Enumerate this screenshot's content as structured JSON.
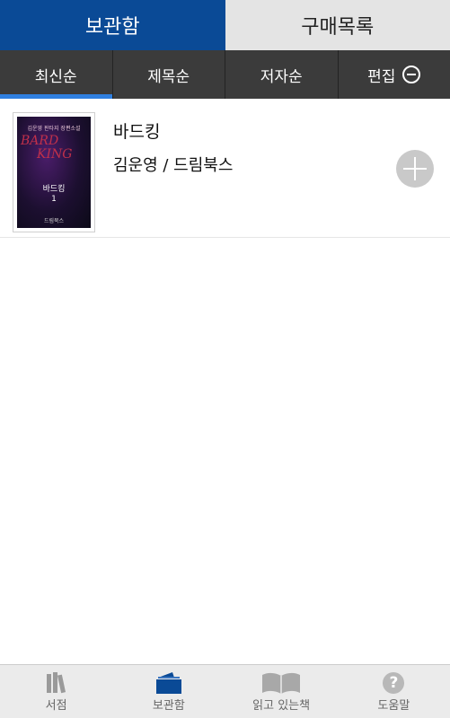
{
  "top_tabs": [
    {
      "label": "보관함",
      "active": true
    },
    {
      "label": "구매목록",
      "active": false
    }
  ],
  "sort_bar": {
    "items": [
      "최신순",
      "제목순",
      "저자순"
    ],
    "active_index": 0,
    "edit_label": "편집",
    "edit_icon": "minus-circle-icon"
  },
  "books": [
    {
      "title": "바드킹",
      "meta": "김운영 / 드림북스",
      "cover": {
        "subtitle": "김운영 판타지 장편소설",
        "logo_line1": "BARD",
        "logo_line2": "KING",
        "title": "바드킹",
        "volume": "1",
        "publisher": "드림북스"
      },
      "action_icon": "plus-circle-icon"
    }
  ],
  "bottom_nav": [
    {
      "label": "서점",
      "icon": "bookshelf-icon"
    },
    {
      "label": "보관함",
      "icon": "book-box-icon"
    },
    {
      "label": "읽고 있는책",
      "icon": "open-book-icon"
    },
    {
      "label": "도움말",
      "icon": "help-icon"
    }
  ],
  "colors": {
    "primary": "#0a4a96",
    "sort_bar_bg": "#3b3b3b",
    "active_underline": "#2f7fe0",
    "nav_bg": "#ebebeb"
  }
}
